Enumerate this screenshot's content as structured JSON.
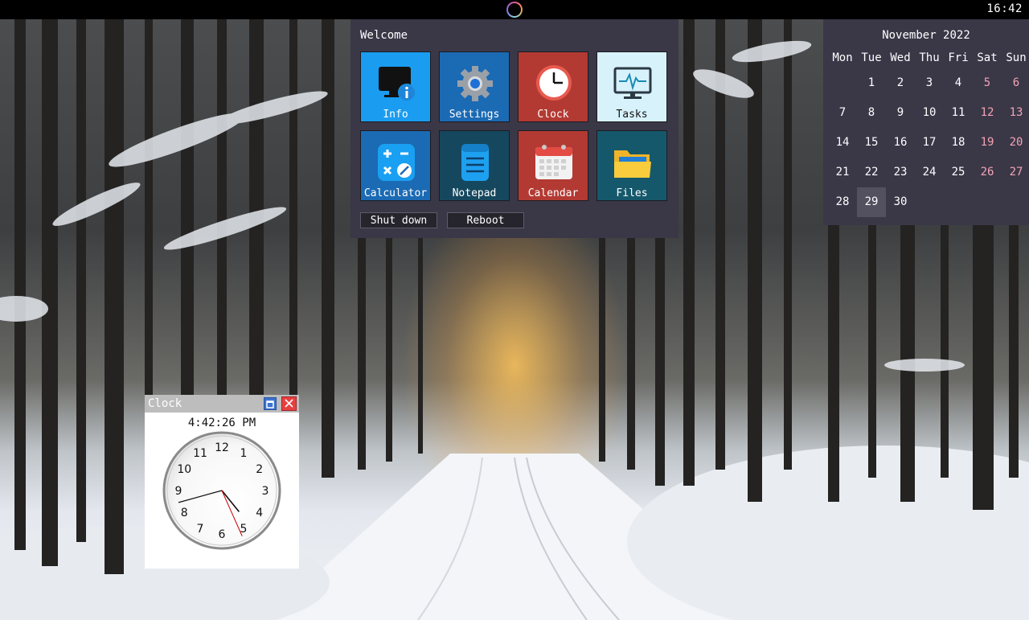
{
  "topbar": {
    "time": "16:42",
    "launcher_icon": "circle-logo-icon"
  },
  "welcome": {
    "title": "Welcome",
    "tiles": [
      {
        "label": "Info",
        "icon": "monitor-info-icon",
        "color": "#1a9cf0"
      },
      {
        "label": "Settings",
        "icon": "gear-icon",
        "color": "#1b6ab4"
      },
      {
        "label": "Clock",
        "icon": "clock-icon",
        "color": "#b33a33"
      },
      {
        "label": "Tasks",
        "icon": "task-monitor-icon",
        "color": "#d8f2fb"
      },
      {
        "label": "Calculator",
        "icon": "calculator-icon",
        "color": "#1b6ab4"
      },
      {
        "label": "Notepad",
        "icon": "notepad-icon",
        "color": "#15485e"
      },
      {
        "label": "Calendar",
        "icon": "calendar-icon",
        "color": "#b33a33"
      },
      {
        "label": "Files",
        "icon": "folder-icon",
        "color": "#15586b"
      }
    ],
    "shutdown_label": "Shut down",
    "reboot_label": "Reboot"
  },
  "calendar": {
    "title": "November 2022",
    "weekdays": [
      "Mon",
      "Tue",
      "Wed",
      "Thu",
      "Fri",
      "Sat",
      "Sun"
    ],
    "weeks": [
      [
        "",
        "1",
        "2",
        "3",
        "4",
        "5",
        "6"
      ],
      [
        "7",
        "8",
        "9",
        "10",
        "11",
        "12",
        "13"
      ],
      [
        "14",
        "15",
        "16",
        "17",
        "18",
        "19",
        "20"
      ],
      [
        "21",
        "22",
        "23",
        "24",
        "25",
        "26",
        "27"
      ],
      [
        "28",
        "29",
        "30",
        "",
        "",
        "",
        ""
      ]
    ],
    "today": "29",
    "weekend_color": "#f3a5b5"
  },
  "clock_window": {
    "title": "Clock",
    "digital_time": "4:42:26 PM",
    "numerals": [
      "12",
      "1",
      "2",
      "3",
      "4",
      "5",
      "6",
      "7",
      "8",
      "9",
      "10",
      "11"
    ],
    "hour": 4,
    "minute": 42,
    "second": 26,
    "second_hand_color": "#cc0000"
  }
}
